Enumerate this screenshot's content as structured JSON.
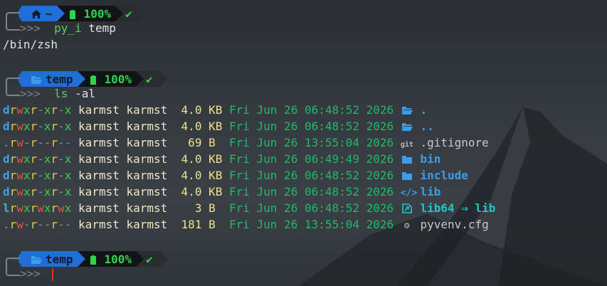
{
  "prompts": [
    {
      "dir": "~",
      "battery": "100%",
      "status": "✔",
      "cmd_name": "py_i",
      "cmd_args": "temp",
      "dir_icon": "home-icon"
    },
    {
      "dir": "temp",
      "battery": "100%",
      "status": "✔",
      "cmd_name": "ls",
      "cmd_args": "-al",
      "dir_icon": "folder-open-icon"
    },
    {
      "dir": "temp",
      "battery": "100%",
      "status": "✔",
      "cmd_name": "",
      "cmd_args": "",
      "dir_icon": "folder-open-icon"
    }
  ],
  "prompt_marker": "╰─>>>",
  "output_line": "/bin/zsh",
  "listing": [
    {
      "perm": "drwxr-xr-x",
      "user": "karmst",
      "group": "karmst",
      "size": "4.0",
      "unit": "KB",
      "date": "Fri Jun 26 06:48:52 2026",
      "icon": "folder-open-icon",
      "name": ".",
      "kind": "dir"
    },
    {
      "perm": "drwxr-xr-x",
      "user": "karmst",
      "group": "karmst",
      "size": "4.0",
      "unit": "KB",
      "date": "Fri Jun 26 06:48:52 2026",
      "icon": "folder-open-icon",
      "name": "..",
      "kind": "dir"
    },
    {
      "perm": ".rw-r--r--",
      "user": "karmst",
      "group": "karmst",
      "size": "69",
      "unit": "B",
      "date": "Fri Jun 26 13:55:04 2026",
      "icon": "git-icon",
      "name": ".gitignore",
      "kind": "file"
    },
    {
      "perm": "drwxr-xr-x",
      "user": "karmst",
      "group": "karmst",
      "size": "4.0",
      "unit": "KB",
      "date": "Fri Jun 26 06:49:49 2026",
      "icon": "folder-icon",
      "name": "bin",
      "kind": "dir"
    },
    {
      "perm": "drwxr-xr-x",
      "user": "karmst",
      "group": "karmst",
      "size": "4.0",
      "unit": "KB",
      "date": "Fri Jun 26 06:48:52 2026",
      "icon": "folder-icon",
      "name": "include",
      "kind": "dir"
    },
    {
      "perm": "drwxr-xr-x",
      "user": "karmst",
      "group": "karmst",
      "size": "4.0",
      "unit": "KB",
      "date": "Fri Jun 26 06:48:52 2026",
      "icon": "code-icon",
      "name": "lib",
      "kind": "dir"
    },
    {
      "perm": "lrwxrwxrwx",
      "user": "karmst",
      "group": "karmst",
      "size": "3",
      "unit": "B",
      "date": "Fri Jun 26 06:48:52 2026",
      "icon": "symlink-icon",
      "name": "lib64 ⇒ lib",
      "kind": "link"
    },
    {
      "perm": ".rw-r--r--",
      "user": "karmst",
      "group": "karmst",
      "size": "181",
      "unit": "B",
      "date": "Fri Jun 26 13:55:04 2026",
      "icon": "gear-icon",
      "name": "pyvenv.cfg",
      "kind": "file"
    }
  ],
  "colors": {
    "dir_segment": "#1f6fd6",
    "battery": "#2fd34a",
    "cursor": "#e0302a"
  }
}
